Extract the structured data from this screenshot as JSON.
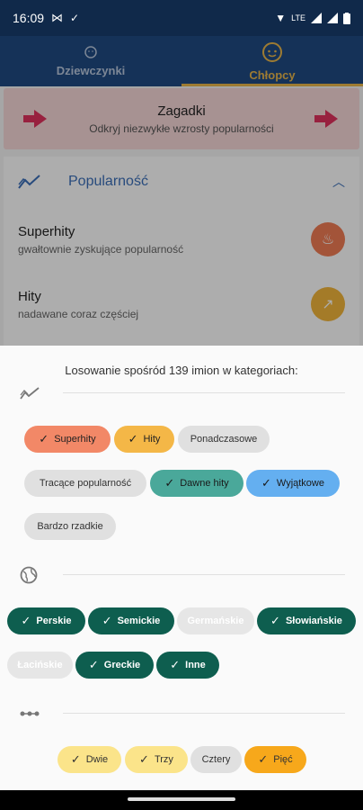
{
  "status": {
    "time": "16:09",
    "network": "LTE"
  },
  "tabs": [
    {
      "label": "Dziewczynki"
    },
    {
      "label": "Chłopcy"
    }
  ],
  "riddle": {
    "title": "Zagadki",
    "subtitle": "Odkryj niezwykłe wzrosty popularności"
  },
  "popularity": {
    "header": "Popularność",
    "rows": [
      {
        "title": "Superhity",
        "subtitle": "gwałtownie zyskujące popularność",
        "color": "#f07d55"
      },
      {
        "title": "Hity",
        "subtitle": "nadawane coraz częściej",
        "color": "#f2b53b"
      }
    ]
  },
  "sheet": {
    "title": "Losowanie spośród 139 imion w kategoriach:",
    "popularity_chips": [
      {
        "label": "Superhity",
        "selected": true
      },
      {
        "label": "Hity",
        "selected": true
      },
      {
        "label": "Ponadczasowe",
        "selected": false
      },
      {
        "label": "Tracące  popularność",
        "selected": false
      },
      {
        "label": "Dawne hity",
        "selected": true
      },
      {
        "label": "Wyjątkowe",
        "selected": true
      },
      {
        "label": "Bardzo rzadkie",
        "selected": false
      }
    ],
    "origin_chips": [
      {
        "label": "Perskie",
        "selected": true
      },
      {
        "label": "Semickie",
        "selected": true
      },
      {
        "label": "Germańskie",
        "selected": false
      },
      {
        "label": "Słowiańskie",
        "selected": true
      },
      {
        "label": "Łacińskie",
        "selected": false
      },
      {
        "label": "Greckie",
        "selected": true
      },
      {
        "label": "Inne",
        "selected": true
      }
    ],
    "syllable_chips": [
      {
        "label": "Dwie",
        "selected": true
      },
      {
        "label": "Trzy",
        "selected": true
      },
      {
        "label": "Cztery",
        "selected": false
      },
      {
        "label": "Pięć",
        "selected": true
      }
    ]
  },
  "icons": {
    "check": "✓",
    "trend": "trend-icon",
    "globe": "globe-icon",
    "syllables": "syllables-icon"
  }
}
